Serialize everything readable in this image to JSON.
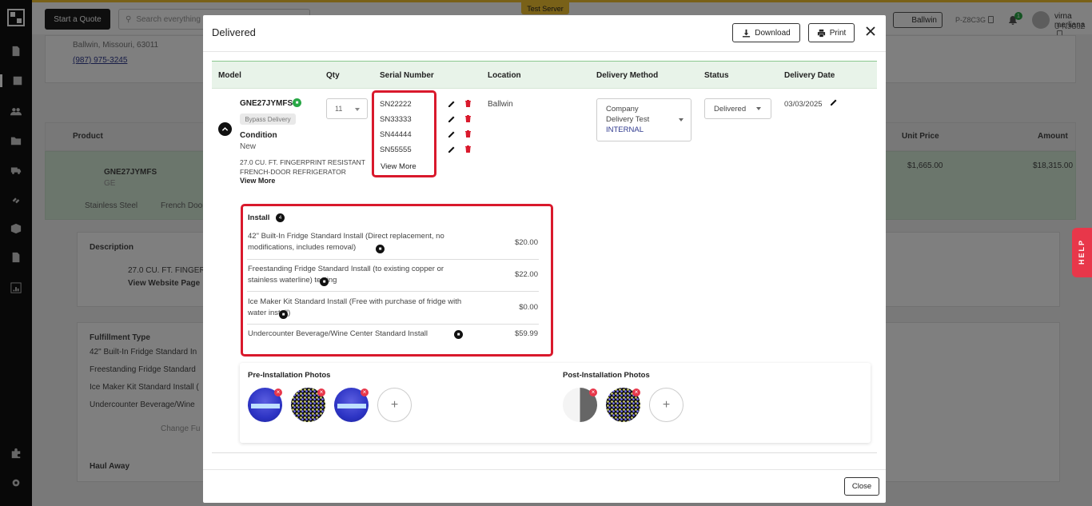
{
  "app": {
    "start_quote": "Start a Quote",
    "search_placeholder": "Search everything",
    "test_server": "Test Server",
    "store_label": "Ballwin",
    "p_code": "P-Z8C3G",
    "notifications": "1",
    "user_name": "virna merliana",
    "user_code": "U-N3C6Z",
    "help": "HELP"
  },
  "background": {
    "address": "Ballwin, Missouri, 63011",
    "phone": "(987) 975-3245",
    "col_product": "Product",
    "col_unit_price": "Unit Price",
    "col_amount": "Amount",
    "row_model": "GNE27JYMFS",
    "row_brand": "GE",
    "row_unit_price": "$1,665.00",
    "row_amount": "$18,315.00",
    "finish": "Stainless Steel",
    "style": "French Door",
    "description_label": "Description",
    "description_text": "27.0 CU. FT. FINGER",
    "view_website": "View Website Page",
    "fulfillment_label": "Fulfillment Type",
    "fulfillment_items": [
      "42\" Built-In Fridge Standard In",
      "Freestanding Fridge Standard",
      "Ice Maker Kit Standard Install (",
      "Undercounter Beverage/Wine"
    ],
    "change_fulfillment": "Change Fu",
    "haul_away": "Haul Away"
  },
  "modal": {
    "title": "Delivered",
    "download": "Download",
    "print": "Print",
    "close": "Close",
    "headers": {
      "model": "Model",
      "qty": "Qty",
      "serial": "Serial Number",
      "location": "Location",
      "method": "Delivery Method",
      "status": "Status",
      "date": "Delivery Date"
    },
    "item": {
      "model": "GNE27JYMFS",
      "bypass": "Bypass Delivery",
      "condition_label": "Condition",
      "condition": "New",
      "description": "27.0 CU. FT. FINGERPRINT RESISTANT FRENCH-DOOR REFRIGERATOR",
      "view_more": "View More",
      "qty": "11",
      "serials": [
        "SN22222",
        "SN33333",
        "SN44444",
        "SN55555"
      ],
      "serial_view_more": "View More",
      "location": "Ballwin",
      "method_lines": [
        "Company",
        "Delivery Test",
        "INTERNAL"
      ],
      "status": "Delivered",
      "date": "03/03/2025"
    },
    "install": {
      "title": "Install",
      "count": "4",
      "items": [
        {
          "text": "42\" Built-In Fridge Standard Install (Direct replacement, no modifications, includes removal)",
          "price": "$20.00"
        },
        {
          "text": "Freestanding Fridge Standard Install (to existing copper or stainless waterline) testing",
          "price": "$22.00"
        },
        {
          "text": "Ice Maker Kit Standard Install (Free with purchase of fridge with water install)",
          "price": "$0.00"
        },
        {
          "text": "Undercounter Beverage/Wine Center Standard Install",
          "price": "$59.99"
        }
      ]
    },
    "photos": {
      "pre_title": "Pre-Installation Photos",
      "post_title": "Post-Installation Photos"
    }
  }
}
